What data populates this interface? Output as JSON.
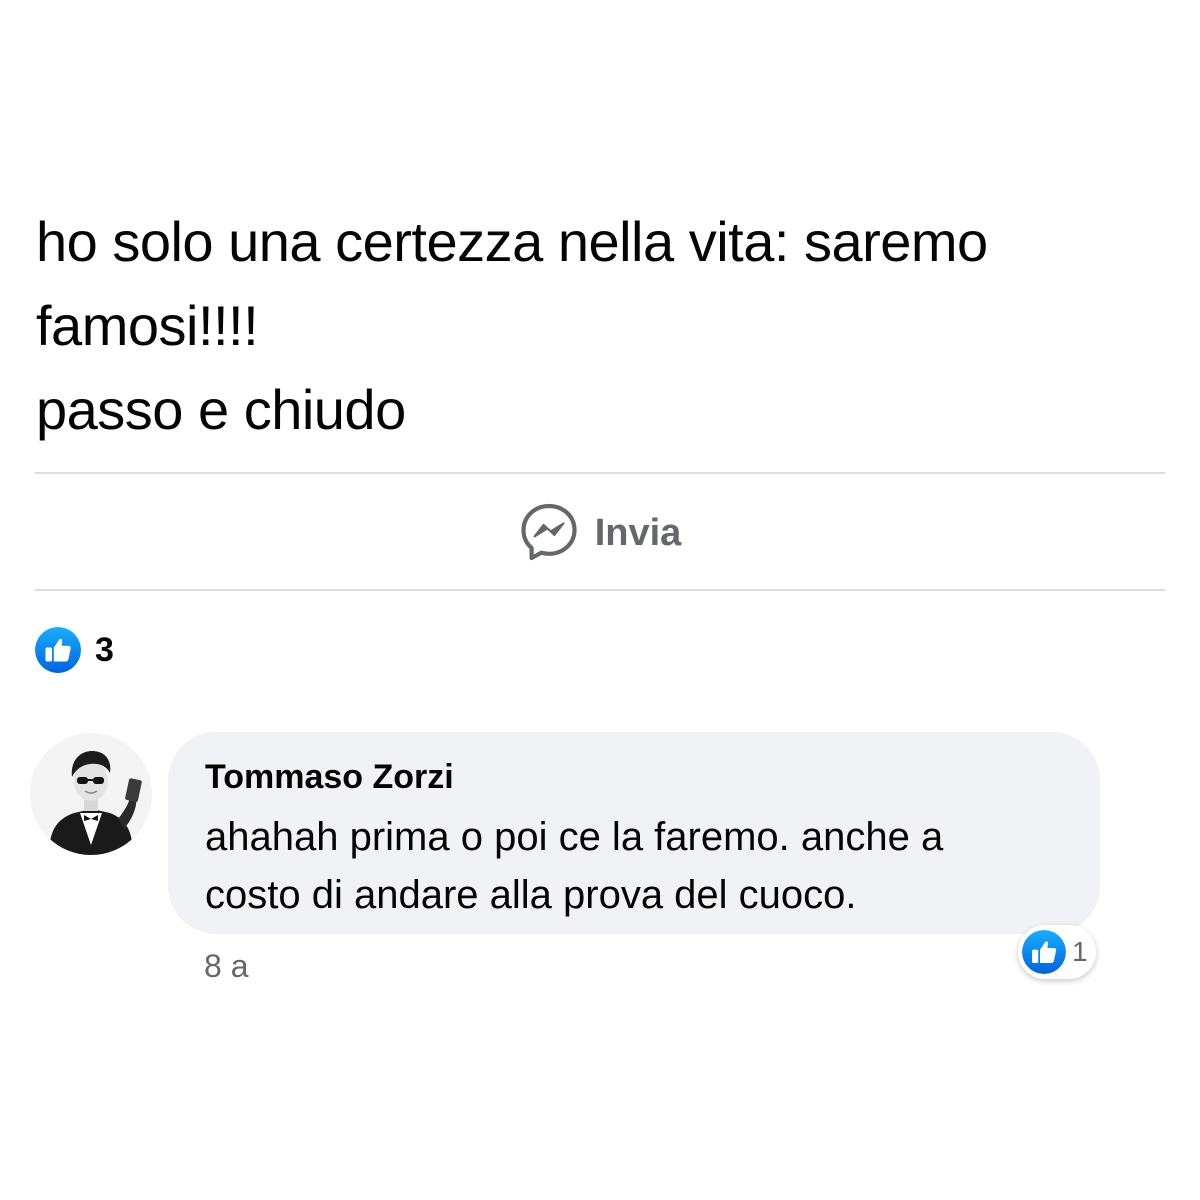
{
  "post": {
    "text_lines": [
      "ho solo una certezza nella vita: saremo",
      "famosi!!!!",
      "passo e chiudo"
    ]
  },
  "actions": {
    "send_label": "Invia",
    "send_icon": "messenger-icon"
  },
  "reactions": {
    "icon": "like-icon",
    "count": "3"
  },
  "comment": {
    "author": "Tommaso Zorzi",
    "text_lines": [
      "ahahah prima o poi ce la faremo. anche a",
      "costo di andare alla prova del cuoco."
    ],
    "time": "8 a",
    "reaction_icon": "like-icon",
    "reaction_count": "1"
  },
  "colors": {
    "like_blue": "#1877f2",
    "secondary_text": "#65676b",
    "bubble_bg": "#f0f2f5",
    "divider": "#dcdde0"
  }
}
